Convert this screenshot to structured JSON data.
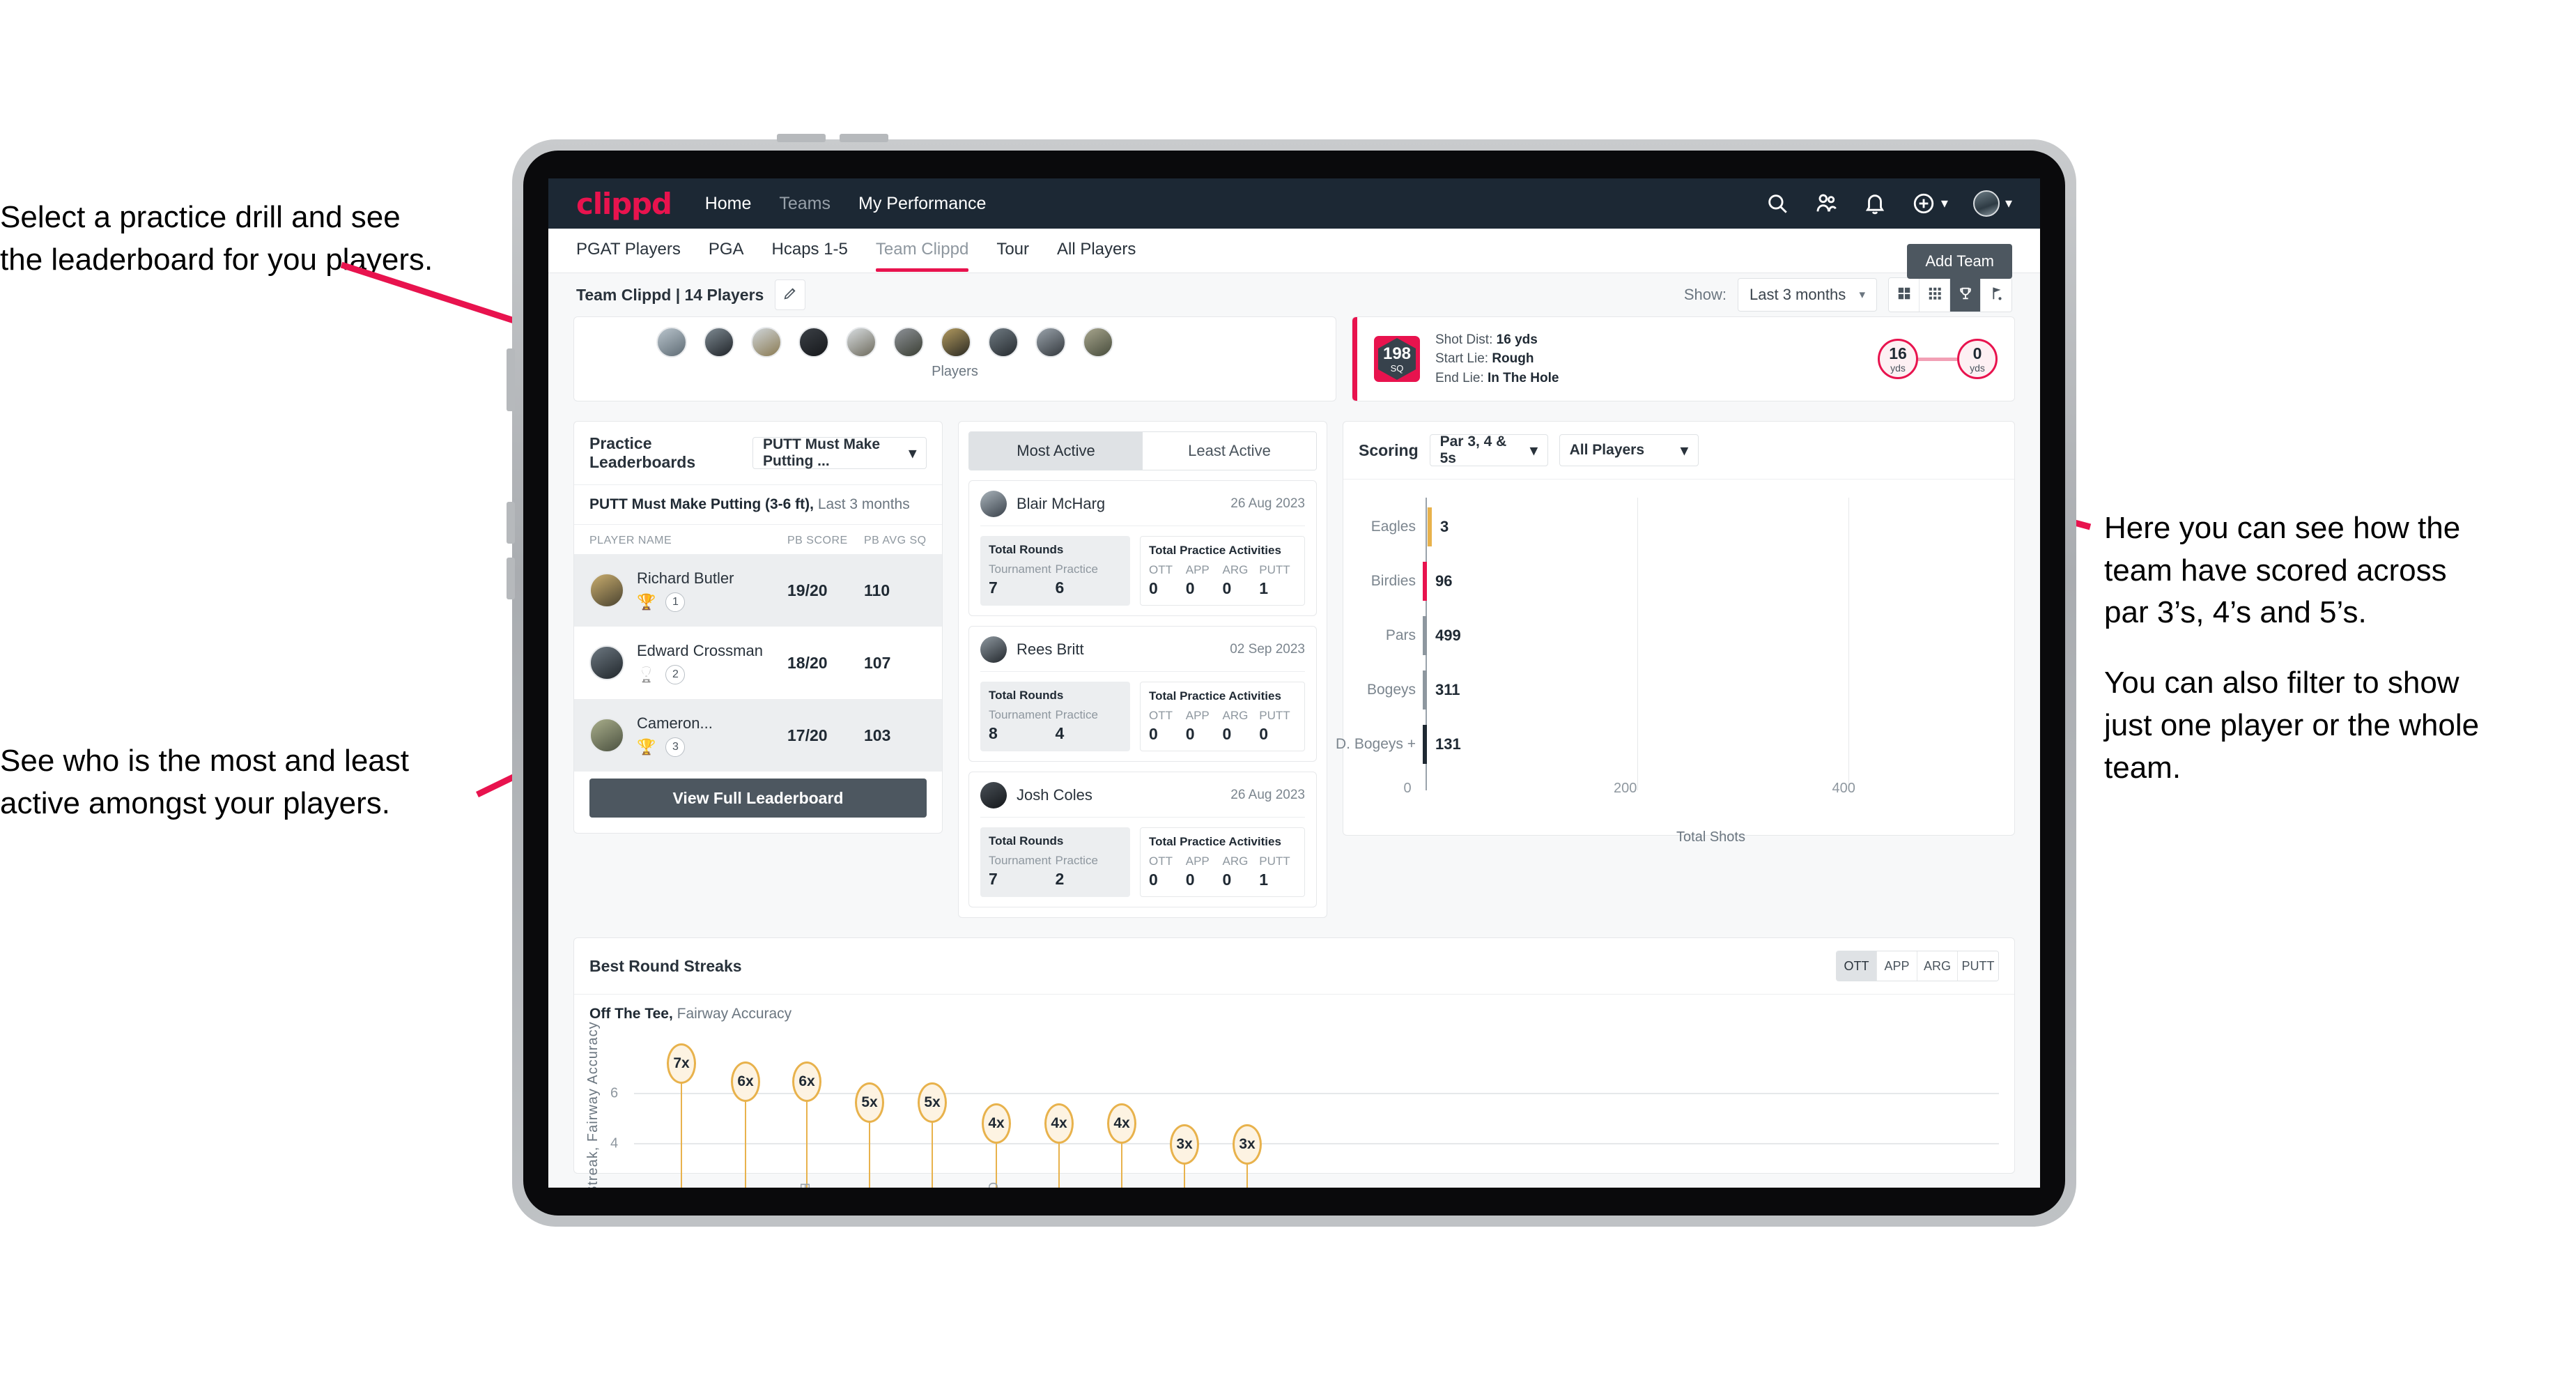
{
  "annotations": {
    "left_top": [
      "Select a practice drill and see",
      "the leaderboard for you players."
    ],
    "left_bottom": [
      "See who is the most and least",
      "active amongst your players."
    ],
    "right": [
      "Here you can see how the",
      "team have scored across",
      "par 3’s, 4’s and 5’s.",
      "You can also filter to show",
      "just one player or the whole",
      "team."
    ]
  },
  "colors": {
    "brand_pink": "#e8134e",
    "navbar": "#1c2834",
    "button_slate": "#4d5760",
    "bar_gray": "#eceef0",
    "gold": "#e8b24c"
  },
  "navbar": {
    "logo": "clippd",
    "links": [
      {
        "label": "Home",
        "dim": false
      },
      {
        "label": "Teams",
        "dim": true
      },
      {
        "label": "My Performance",
        "dim": false
      }
    ],
    "icons": [
      "search-icon",
      "people-icon",
      "bell-icon",
      "plus-circle-icon",
      "avatar"
    ]
  },
  "tabs": {
    "items": [
      {
        "label": "PGAT Players",
        "active": false
      },
      {
        "label": "PGA",
        "active": false
      },
      {
        "label": "Hcaps 1-5",
        "active": false
      },
      {
        "label": "Team Clippd",
        "active": true
      },
      {
        "label": "Tour",
        "active": false
      },
      {
        "label": "All Players",
        "active": false
      }
    ],
    "add_team_label": "Add Team"
  },
  "filter_row": {
    "team_label": "Team Clippd | 14 Players",
    "edit_icon": "pencil-icon",
    "show_label": "Show:",
    "show_value": "Last 3 months",
    "view_toggles": [
      {
        "icon": "grid-large-icon",
        "active": false
      },
      {
        "icon": "grid-small-icon",
        "active": false
      },
      {
        "icon": "trophy-icon",
        "active": true
      },
      {
        "icon": "flag-icon",
        "active": false
      }
    ]
  },
  "players_strip": {
    "caption": "Players",
    "count": 10
  },
  "shot_card": {
    "badge_number": "198",
    "badge_unit": "SQ",
    "lines": [
      {
        "label": "Shot Dist:",
        "value": "16 yds"
      },
      {
        "label": "Start Lie:",
        "value": "Rough"
      },
      {
        "label": "End Lie:",
        "value": "In The Hole"
      }
    ],
    "start_dist": "16",
    "start_unit": "yds",
    "end_dist": "0",
    "end_unit": "yds"
  },
  "leaderboard": {
    "title": "Practice Leaderboards",
    "drill_select": "PUTT Must Make Putting ...",
    "subtitle_bold": "PUTT Must Make Putting (3-6 ft),",
    "subtitle_rest": " Last 3 months",
    "columns": [
      "PLAYER NAME",
      "PB SCORE",
      "PB AVG SQ"
    ],
    "rows": [
      {
        "name": "Richard Butler",
        "rank": "1",
        "trophy": "gold",
        "score": "19/20",
        "avg": "110"
      },
      {
        "name": "Edward Crossman",
        "rank": "2",
        "trophy": "silver",
        "score": "18/20",
        "avg": "107"
      },
      {
        "name": "Cameron...",
        "rank": "3",
        "trophy": "bronze",
        "score": "17/20",
        "avg": "103"
      }
    ],
    "button_label": "View Full Leaderboard"
  },
  "activity": {
    "tabs": [
      {
        "label": "Most Active",
        "active": true
      },
      {
        "label": "Least Active",
        "active": false
      }
    ],
    "rounds_title": "Total Rounds",
    "rounds_labels": [
      "Tournament",
      "Practice"
    ],
    "practice_title": "Total Practice Activities",
    "practice_labels": [
      "OTT",
      "APP",
      "ARG",
      "PUTT"
    ],
    "players": [
      {
        "name": "Blair McHarg",
        "date": "26 Aug 2023",
        "rounds": [
          "7",
          "6"
        ],
        "practice": [
          "0",
          "0",
          "0",
          "1"
        ]
      },
      {
        "name": "Rees Britt",
        "date": "02 Sep 2023",
        "rounds": [
          "8",
          "4"
        ],
        "practice": [
          "0",
          "0",
          "0",
          "0"
        ]
      },
      {
        "name": "Josh Coles",
        "date": "26 Aug 2023",
        "rounds": [
          "7",
          "2"
        ],
        "practice": [
          "0",
          "0",
          "0",
          "1"
        ]
      }
    ]
  },
  "scoring": {
    "title": "Scoring",
    "par_select": "Par 3, 4 & 5s",
    "player_select": "All Players"
  },
  "streaks": {
    "title": "Best Round Streaks",
    "toggles": [
      {
        "label": "OTT",
        "active": true
      },
      {
        "label": "APP",
        "active": false
      },
      {
        "label": "ARG",
        "active": false
      },
      {
        "label": "PUTT",
        "active": false
      }
    ],
    "sub_bold": "Off The Tee,",
    "sub_rest": " Fairway Accuracy"
  },
  "chart_data": [
    {
      "type": "bar",
      "orientation": "horizontal",
      "title": "Scoring",
      "categories": [
        "Eagles",
        "Birdies",
        "Pars",
        "Bogeys",
        "D. Bogeys +"
      ],
      "values": [
        3,
        96,
        499,
        311,
        131
      ],
      "cap_colors": [
        "#e8b24c",
        "#e8134e",
        "#8e979f",
        "#8e979f",
        "#1f2933"
      ],
      "xlabel": "Total Shots",
      "ylabel": "",
      "xlim": [
        0,
        540
      ],
      "xticks": [
        0,
        200,
        400
      ],
      "grid": true,
      "legend": "none"
    },
    {
      "type": "bar",
      "orientation": "vertical",
      "variant": "lollipop",
      "title": "Best Round Streaks",
      "subtitle": "Off The Tee, Fairway Accuracy",
      "ylabel": "Streak, Fairway Accuracy",
      "ylim": [
        0,
        8
      ],
      "yticks": [
        4,
        6
      ],
      "grid": true,
      "values": [
        7,
        6,
        6,
        5,
        5,
        4,
        4,
        4,
        3,
        3
      ],
      "labels": [
        "7x",
        "6x",
        "6x",
        "5x",
        "5x",
        "4x",
        "4x",
        "4x",
        "3x",
        "3x"
      ],
      "legend": "none"
    }
  ]
}
